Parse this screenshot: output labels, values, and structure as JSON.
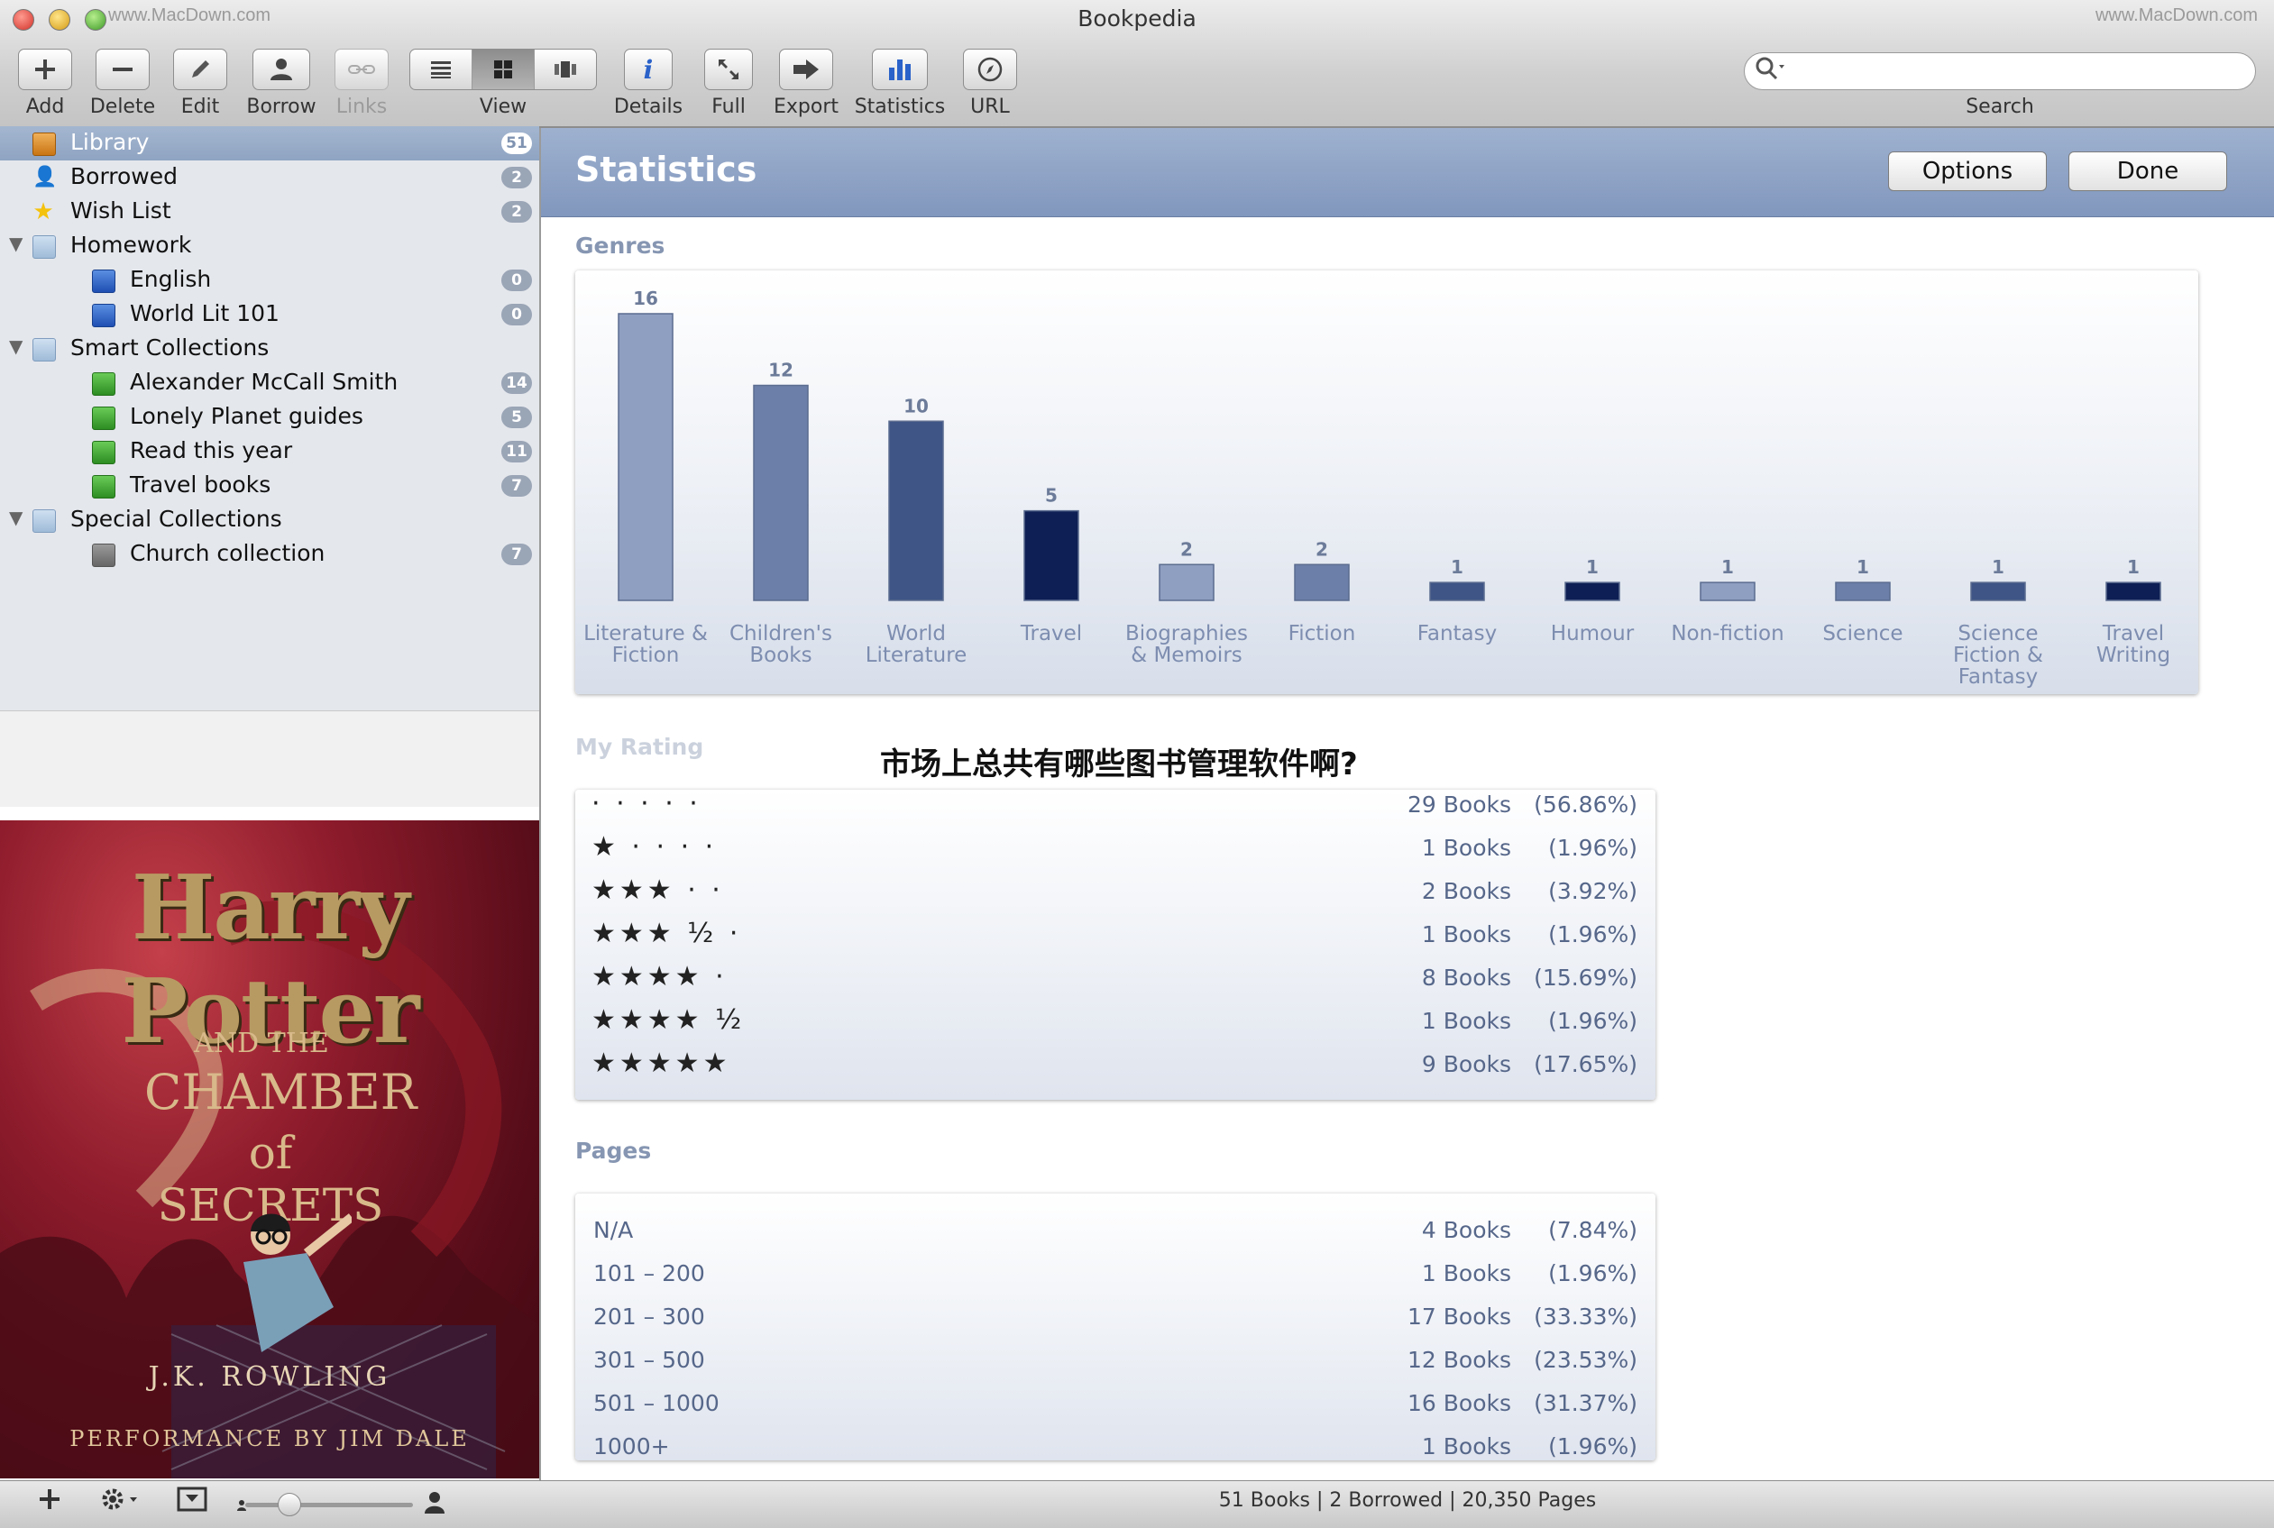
{
  "window": {
    "title": "Bookpedia",
    "watermark_left": "www.MacDown.com",
    "watermark_right": "www.MacDown.com"
  },
  "toolbar": {
    "add": "Add",
    "delete": "Delete",
    "edit": "Edit",
    "borrow": "Borrow",
    "links": "Links",
    "view": "View",
    "details": "Details",
    "full": "Full",
    "export": "Export",
    "statistics": "Statistics",
    "url": "URL",
    "search_label": "Search",
    "search_value": "",
    "details_icon": "i"
  },
  "sidebar": {
    "items": [
      {
        "label": "Library",
        "count": "51",
        "icon": "library-icon"
      },
      {
        "label": "Borrowed",
        "count": "2",
        "icon": "person-icon"
      },
      {
        "label": "Wish List",
        "count": "2",
        "icon": "star-icon"
      },
      {
        "label": "Homework",
        "icon": "folder-icon"
      },
      {
        "label": "English",
        "count": "0",
        "icon": "blue-book-icon"
      },
      {
        "label": "World Lit 101",
        "count": "0",
        "icon": "blue-book-icon"
      },
      {
        "label": "Smart Collections",
        "icon": "folder-icon"
      },
      {
        "label": "Alexander McCall Smith",
        "count": "14",
        "icon": "green-book-icon"
      },
      {
        "label": "Lonely Planet guides",
        "count": "5",
        "icon": "green-book-icon"
      },
      {
        "label": "Read this year",
        "count": "11",
        "icon": "green-book-icon"
      },
      {
        "label": "Travel books",
        "count": "7",
        "icon": "green-book-icon"
      },
      {
        "label": "Special Collections",
        "icon": "folder-icon"
      },
      {
        "label": "Church collection",
        "count": "7",
        "icon": "gray-book-icon"
      }
    ]
  },
  "cover": {
    "title": "Harry Potter",
    "subtitle_line1": "AND THE",
    "subtitle_line2": "CHAMBER",
    "subtitle_line3": "of SECRETS",
    "author": "J.K. ROWLING",
    "performer": "PERFORMANCE BY JIM DALE"
  },
  "content": {
    "title": "Statistics",
    "options": "Options",
    "done": "Done",
    "genres_title": "Genres",
    "rating_title": "My Rating",
    "pages_title": "Pages"
  },
  "chart_data": {
    "type": "bar",
    "title": "Genres",
    "categories": [
      "Literature & Fiction",
      "Children's Books",
      "World Literature",
      "Travel",
      "Biographies & Memoirs",
      "Fiction",
      "Fantasy",
      "Humour",
      "Non-fiction",
      "Science",
      "Science Fiction & Fantasy",
      "Travel Writing"
    ],
    "category_lines": [
      [
        "Literature &",
        "Fiction"
      ],
      [
        "Children's",
        "Books"
      ],
      [
        "World",
        "Literature"
      ],
      [
        "Travel"
      ],
      [
        "Biographies",
        "& Memoirs"
      ],
      [
        "Fiction"
      ],
      [
        "Fantasy"
      ],
      [
        "Humour"
      ],
      [
        "Non-fiction"
      ],
      [
        "Science"
      ],
      [
        "Science",
        "Fiction &",
        "Fantasy"
      ],
      [
        "Travel",
        "Writing"
      ]
    ],
    "values": [
      16,
      12,
      10,
      5,
      2,
      2,
      1,
      1,
      1,
      1,
      1,
      1
    ],
    "bar_colors": [
      "#8e9fc2",
      "#6b7fa8",
      "#3e5586",
      "#0e1f55",
      "#8e9fc2",
      "#6b7fa8",
      "#3e5586",
      "#0e1f55",
      "#8e9fc2",
      "#6b7fa8",
      "#3e5586",
      "#0e1f55"
    ],
    "ylim": [
      0,
      16
    ],
    "grid": false,
    "legend": "none"
  },
  "rating": {
    "rows": [
      {
        "stars": "· · · · ·",
        "count": "29 Books",
        "pct": "(56.86%)"
      },
      {
        "stars": "★ · · · ·",
        "count": "1 Books",
        "pct": "(1.96%)"
      },
      {
        "stars": "★★★ · ·",
        "count": "2 Books",
        "pct": "(3.92%)"
      },
      {
        "stars": "★★★ ½ ·",
        "count": "1 Books",
        "pct": "(1.96%)"
      },
      {
        "stars": "★★★★ ·",
        "count": "8 Books",
        "pct": "(15.69%)"
      },
      {
        "stars": "★★★★ ½",
        "count": "1 Books",
        "pct": "(1.96%)"
      },
      {
        "stars": "★★★★★",
        "count": "9 Books",
        "pct": "(17.65%)"
      }
    ]
  },
  "pages": {
    "rows": [
      {
        "label": "N/A",
        "count": "4 Books",
        "pct": "(7.84%)"
      },
      {
        "label": "101 – 200",
        "count": "1 Books",
        "pct": "(1.96%)"
      },
      {
        "label": "201 – 300",
        "count": "17 Books",
        "pct": "(33.33%)"
      },
      {
        "label": "301 – 500",
        "count": "12 Books",
        "pct": "(23.53%)"
      },
      {
        "label": "501 – 1000",
        "count": "16 Books",
        "pct": "(31.37%)"
      },
      {
        "label": "1000+",
        "count": "1 Books",
        "pct": "(1.96%)"
      }
    ]
  },
  "status": {
    "text": "51 Books | 2 Borrowed | 20,350 Pages"
  },
  "overlay": {
    "caption": "市场上总共有哪些图书管理软件啊?"
  }
}
